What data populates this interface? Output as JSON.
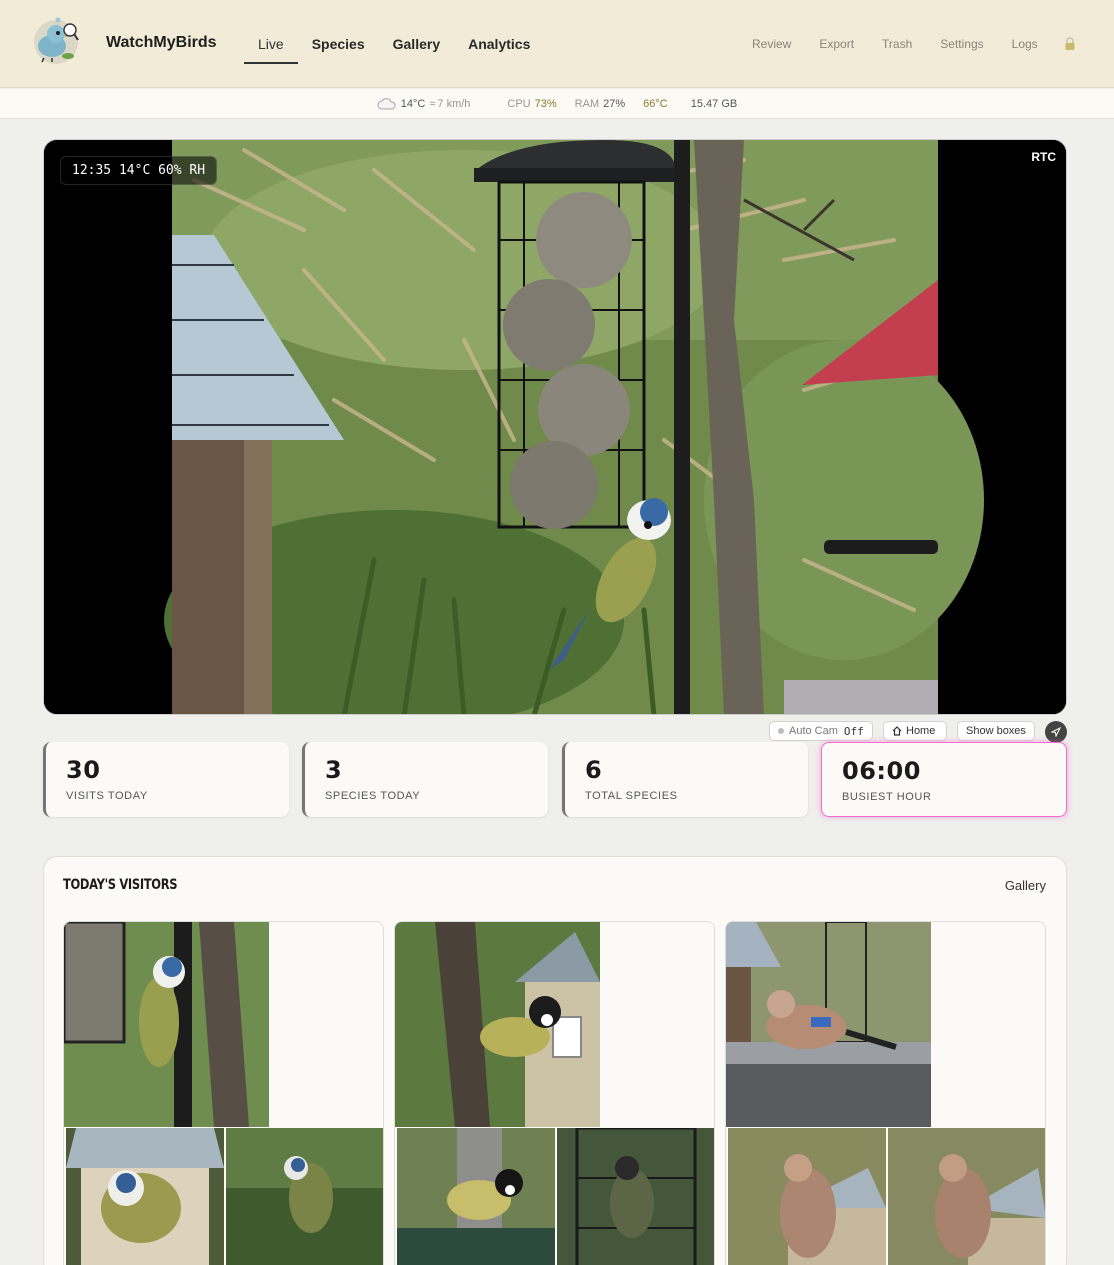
{
  "header": {
    "brand": "WatchMyBirds",
    "tabs": [
      {
        "label": "Live",
        "active": true
      },
      {
        "label": "Species"
      },
      {
        "label": "Gallery"
      },
      {
        "label": "Analytics"
      }
    ],
    "secondary": [
      {
        "label": "Review"
      },
      {
        "label": "Export"
      },
      {
        "label": "Trash"
      },
      {
        "label": "Settings"
      },
      {
        "label": "Logs"
      }
    ],
    "lock_icon": "lock-icon"
  },
  "status": {
    "weather_temp": "14°C",
    "wind": "7 km/h",
    "cpu_label": "CPU",
    "cpu_value": "73%",
    "ram_label": "RAM",
    "ram_value": "27%",
    "cpu_temp": "66°C",
    "disk": "15.47 GB"
  },
  "video": {
    "osd": "12:35 14°C 60% RH",
    "badge": "RTC"
  },
  "cam_controls": {
    "auto_cam_label": "Auto Cam",
    "auto_cam_value": "Off",
    "home_label": "Home",
    "show_boxes_label": "Show boxes"
  },
  "stats": [
    {
      "value": "30",
      "label": "VISITS TODAY"
    },
    {
      "value": "3",
      "label": "SPECIES TODAY"
    },
    {
      "value": "6",
      "label": "TOTAL SPECIES"
    },
    {
      "value": "06:00",
      "label": "BUSIEST HOUR",
      "highlight": true
    }
  ],
  "visitors": {
    "title": "TODAY'S VISITORS",
    "link": "Gallery"
  },
  "colors": {
    "header_bg": "#f1ebd7",
    "accent_highlight": "#f070d0",
    "ok_metric": "#8a7a2e"
  }
}
